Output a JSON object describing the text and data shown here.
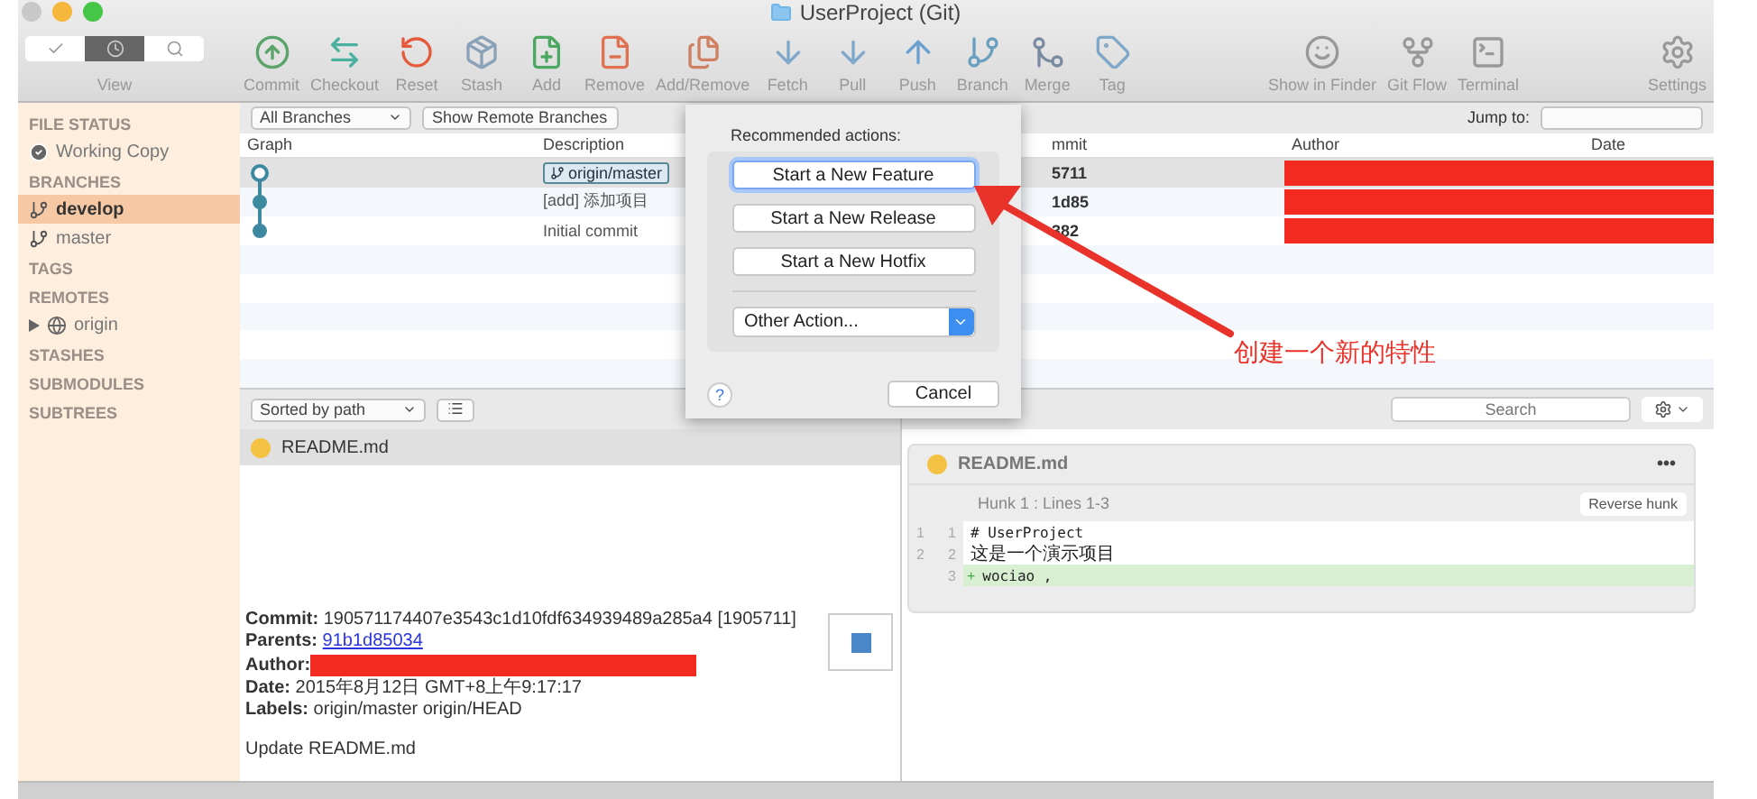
{
  "window": {
    "title": "UserProject (Git)"
  },
  "toolbar": {
    "view": {
      "label": "View",
      "segments": [
        {
          "selected": false
        },
        {
          "selected": true
        },
        {
          "selected": false
        }
      ]
    },
    "groups": [
      [
        {
          "label": "Commit"
        },
        {
          "label": "Checkout"
        },
        {
          "label": "Reset"
        },
        {
          "label": "Stash"
        },
        {
          "label": "Add"
        },
        {
          "label": "Remove"
        },
        {
          "label": "Add/Remove"
        },
        {
          "label": "Fetch"
        },
        {
          "label": "Pull"
        },
        {
          "label": "Push"
        },
        {
          "label": "Branch"
        },
        {
          "label": "Merge"
        },
        {
          "label": "Tag"
        }
      ],
      [
        {
          "label": "Show in Finder"
        },
        {
          "label": "Git Flow"
        },
        {
          "label": "Terminal"
        }
      ],
      [
        {
          "label": "Settings"
        }
      ]
    ]
  },
  "sidebar": {
    "sections": [
      {
        "title": "FILE STATUS",
        "items": [
          {
            "label": "Working Copy",
            "kind": "status",
            "selected": false
          }
        ]
      },
      {
        "title": "BRANCHES",
        "items": [
          {
            "label": "develop",
            "kind": "branch",
            "selected": true
          },
          {
            "label": "master",
            "kind": "branch",
            "selected": false
          }
        ]
      },
      {
        "title": "TAGS"
      },
      {
        "title": "REMOTES",
        "items": [
          {
            "label": "origin",
            "kind": "remote",
            "selected": false,
            "expanded": false
          }
        ]
      },
      {
        "title": "STASHES"
      },
      {
        "title": "SUBMODULES"
      },
      {
        "title": "SUBTREES"
      }
    ]
  },
  "filter_bar": {
    "branches": "All Branches",
    "remote_button": "Show Remote Branches",
    "jump_label": "Jump to:"
  },
  "table": {
    "columns": [
      "Graph",
      "Description",
      "mmit",
      "Author",
      "Date"
    ],
    "rows": [
      {
        "kind": "head",
        "tag": "origin/master",
        "commit": "5711",
        "author_redacted": true,
        "selected": true
      },
      {
        "kind": "commit",
        "description": "[add] 添加项目",
        "commit": "1d85",
        "author_redacted": true,
        "selected": false
      },
      {
        "kind": "commit",
        "description": "Initial commit",
        "commit": "382",
        "author_redacted": true,
        "selected": false
      }
    ]
  },
  "files": {
    "sort": "Sorted by path",
    "items": [
      {
        "name": "README.md"
      }
    ]
  },
  "details": {
    "commit_label": "Commit:",
    "commit": "190571174407e3543c1d10fdf634939489a285a4 [1905711]",
    "parents_label": "Parents:",
    "parents": "91b1d85034",
    "author_label": "Author:",
    "author_redacted": true,
    "date_label": "Date:",
    "date": "2015年8月12日 GMT+8上午9:17:17",
    "labels_label": "Labels:",
    "labels": "origin/master origin/HEAD",
    "message": "Update README.md"
  },
  "diff": {
    "search": {
      "placeholder": "Search"
    },
    "file": "README.md",
    "more": "•••",
    "hunk": "Hunk 1 : Lines 1-3",
    "reverse": "Reverse hunk",
    "lines": [
      {
        "kind": "context",
        "old": "1",
        "new": "1",
        "text": "# UserProject"
      },
      {
        "kind": "context",
        "old": "2",
        "new": "2",
        "text": "这是一个演示项目"
      },
      {
        "kind": "added",
        "new": "3",
        "sign": "+",
        "text": "wociao ,"
      }
    ]
  },
  "dialog": {
    "heading": "Recommended actions:",
    "actions": [
      {
        "label": "Start a New Feature",
        "selected": true
      },
      {
        "label": "Start a New Release",
        "selected": false
      },
      {
        "label": "Start a New Hotfix",
        "selected": false
      }
    ],
    "other": "Other Action...",
    "help": "?",
    "cancel": "Cancel"
  },
  "annotation": {
    "text": "创建一个新的特性"
  }
}
